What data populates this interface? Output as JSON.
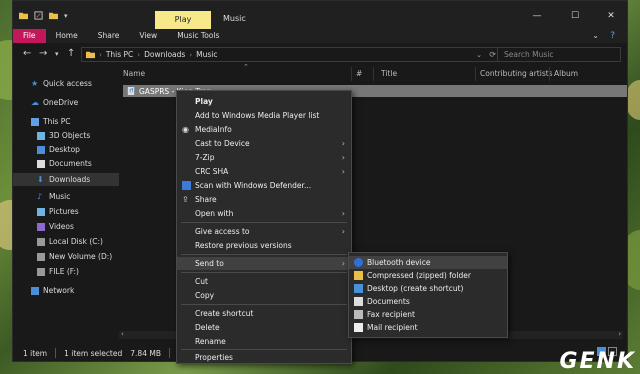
{
  "window": {
    "title": "Music",
    "contextual_tab_group": "Play",
    "controls": {
      "minimize": "—",
      "maximize": "☐",
      "close": "✕"
    }
  },
  "ribbon": {
    "tabs": [
      "File",
      "Home",
      "Share",
      "View",
      "Music Tools"
    ],
    "help": "?"
  },
  "address": {
    "breadcrumbs": [
      "This PC",
      "Downloads",
      "Music"
    ],
    "search_placeholder": "Search Music"
  },
  "nav_pane": {
    "items": [
      {
        "label": "Quick access",
        "icon": "star-icon"
      },
      {
        "label": "OneDrive",
        "icon": "cloud-icon"
      },
      {
        "label": "This PC",
        "icon": "computer-icon"
      },
      {
        "label": "3D Objects",
        "icon": "cube-icon"
      },
      {
        "label": "Desktop",
        "icon": "desktop-icon"
      },
      {
        "label": "Documents",
        "icon": "document-icon"
      },
      {
        "label": "Downloads",
        "icon": "download-icon"
      },
      {
        "label": "Music",
        "icon": "music-note-icon"
      },
      {
        "label": "Pictures",
        "icon": "picture-icon"
      },
      {
        "label": "Videos",
        "icon": "video-icon"
      },
      {
        "label": "Local Disk (C:)",
        "icon": "drive-icon"
      },
      {
        "label": "New Volume (D:)",
        "icon": "drive-icon"
      },
      {
        "label": "FILE (F:)",
        "icon": "drive-icon"
      },
      {
        "label": "Network",
        "icon": "network-icon"
      }
    ],
    "selected": "Downloads"
  },
  "columns": [
    "Name",
    "#",
    "Title",
    "Contributing artists",
    "Album"
  ],
  "file": {
    "name": "GASPRS - Kien Tran"
  },
  "context_menu": {
    "items": [
      "Play",
      "Add to Windows Media Player list",
      "MediaInfo",
      "Cast to Device",
      "7-Zip",
      "CRC SHA",
      "Scan with Windows Defender...",
      "Share",
      "Open with",
      "Give access to",
      "Restore previous versions",
      "Send to",
      "Cut",
      "Copy",
      "Create shortcut",
      "Delete",
      "Rename",
      "Properties"
    ],
    "submenu_arrow": "›"
  },
  "send_to_menu": {
    "items": [
      {
        "label": "Bluetooth device",
        "icon": "bluetooth-icon"
      },
      {
        "label": "Compressed (zipped) folder",
        "icon": "zip-folder-icon"
      },
      {
        "label": "Desktop (create shortcut)",
        "icon": "desktop-icon"
      },
      {
        "label": "Documents",
        "icon": "document-icon"
      },
      {
        "label": "Fax recipient",
        "icon": "fax-icon"
      },
      {
        "label": "Mail recipient",
        "icon": "mail-icon"
      }
    ]
  },
  "status": {
    "count": "1 item",
    "selected": "1 item selected",
    "size": "7.84 MB"
  },
  "watermark": "GENK",
  "colors": {
    "accent_file_tab": "#c2185b",
    "contextual_tab": "#f7e98a",
    "folder": "#e8c04a",
    "link_blue": "#4a90d9"
  }
}
